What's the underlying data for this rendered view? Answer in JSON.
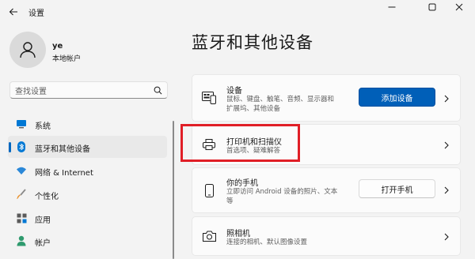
{
  "window": {
    "title": "设置",
    "controls": [
      "minimize",
      "maximize",
      "close"
    ]
  },
  "profile": {
    "name": "ye",
    "account_type": "本地帐户"
  },
  "search": {
    "placeholder": "查找设置"
  },
  "sidebar": {
    "items": [
      {
        "label": "系统",
        "icon": "monitor-icon",
        "selected": false
      },
      {
        "label": "蓝牙和其他设备",
        "icon": "bluetooth-icon",
        "selected": true
      },
      {
        "label": "网络 & Internet",
        "icon": "wifi-icon",
        "selected": false
      },
      {
        "label": "个性化",
        "icon": "brush-icon",
        "selected": false
      },
      {
        "label": "应用",
        "icon": "apps-icon",
        "selected": false
      },
      {
        "label": "帐户",
        "icon": "person-icon",
        "selected": false
      }
    ]
  },
  "main": {
    "title": "蓝牙和其他设备",
    "cards": [
      {
        "title": "设备",
        "desc_line1": "鼠标、键盘、触笔、音频、显示器和",
        "desc_line2": "扩展坞、其他设备",
        "button": "添加设备",
        "icon": "devices-icon"
      },
      {
        "title": "打印机和扫描仪",
        "desc_line1": "首选项、疑难解答",
        "icon": "printer-icon"
      },
      {
        "title": "你的手机",
        "desc_line1": "立即访问 Android 设备的照片、文本",
        "desc_line2": "等",
        "button": "打开手机",
        "icon": "phone-icon"
      },
      {
        "title": "照相机",
        "desc_line1": "连接的相机、默认图像设置",
        "icon": "camera-icon"
      }
    ]
  },
  "colors": {
    "accent": "#005fb8",
    "highlight": "#e01e26",
    "background": "#f3f3f3",
    "card": "#fbfbfb"
  }
}
